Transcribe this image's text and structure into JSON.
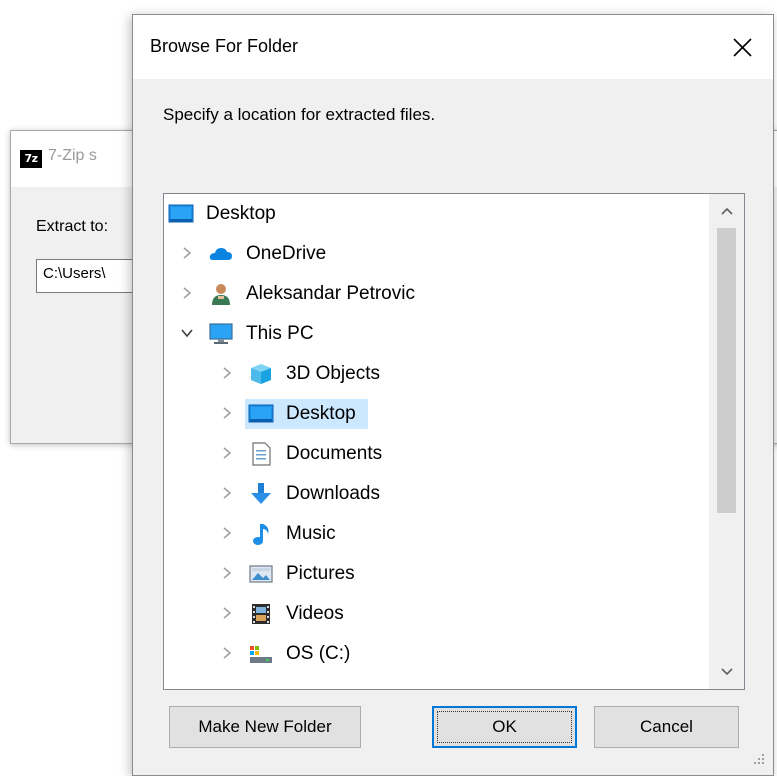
{
  "background_window": {
    "title": "7-Zip s",
    "extract_label": "Extract to:",
    "path_value": "C:\\Users\\"
  },
  "dialog": {
    "title": "Browse For Folder",
    "instruction": "Specify a location for extracted files.",
    "tree": [
      {
        "label": "Desktop",
        "icon": "desktop-blue-icon",
        "level": 0,
        "expander": "none"
      },
      {
        "label": "OneDrive",
        "icon": "cloud-icon",
        "level": 1,
        "expander": "collapsed"
      },
      {
        "label": "Aleksandar Petrovic",
        "icon": "user-icon",
        "level": 1,
        "expander": "collapsed"
      },
      {
        "label": "This PC",
        "icon": "computer-icon",
        "level": 1,
        "expander": "expanded"
      },
      {
        "label": "3D Objects",
        "icon": "cube-icon",
        "level": 2,
        "expander": "collapsed"
      },
      {
        "label": "Desktop",
        "icon": "desktop-blue-icon",
        "level": 2,
        "expander": "collapsed",
        "selected": true
      },
      {
        "label": "Documents",
        "icon": "document-icon",
        "level": 2,
        "expander": "collapsed"
      },
      {
        "label": "Downloads",
        "icon": "download-arrow-icon",
        "level": 2,
        "expander": "collapsed"
      },
      {
        "label": "Music",
        "icon": "music-note-icon",
        "level": 2,
        "expander": "collapsed"
      },
      {
        "label": "Pictures",
        "icon": "picture-icon",
        "level": 2,
        "expander": "collapsed"
      },
      {
        "label": "Videos",
        "icon": "film-icon",
        "level": 2,
        "expander": "collapsed"
      },
      {
        "label": "OS (C:)",
        "icon": "drive-icon",
        "level": 2,
        "expander": "collapsed"
      }
    ],
    "buttons": {
      "make_new_folder": "Make New Folder",
      "ok": "OK",
      "cancel": "Cancel"
    }
  },
  "colors": {
    "selection": "#cce8ff",
    "default_button_border": "#0078d7",
    "window_background": "#f0f0f0"
  }
}
